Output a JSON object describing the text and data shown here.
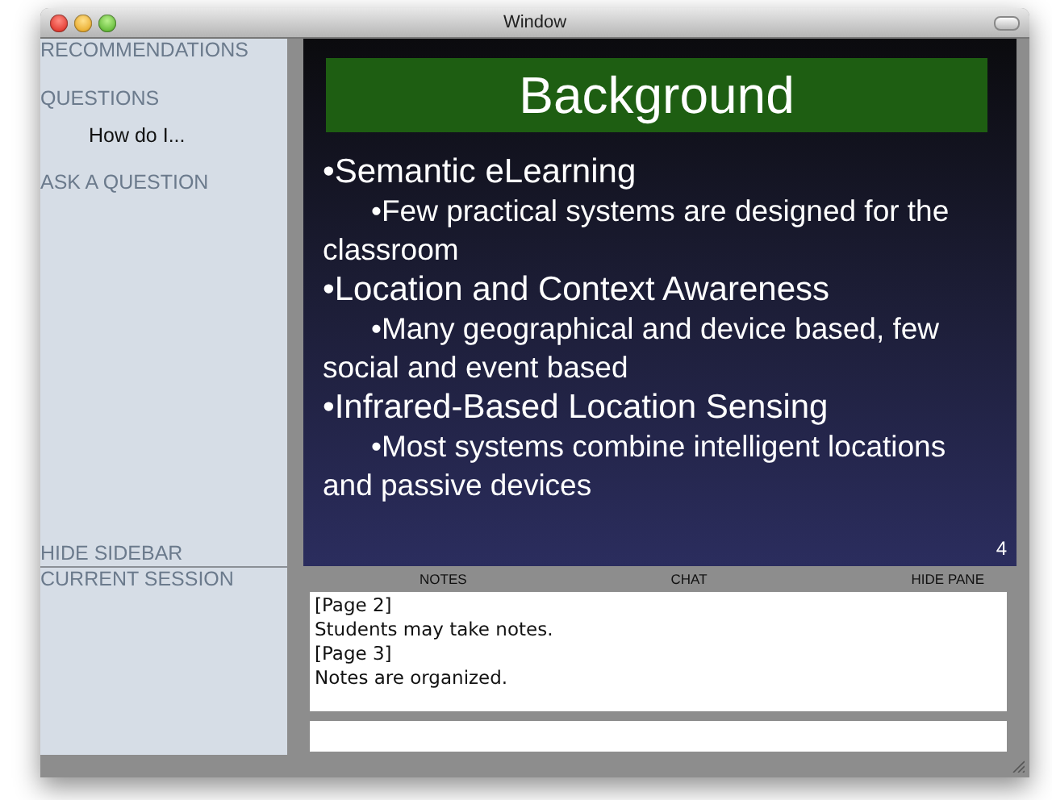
{
  "window": {
    "title": "Window"
  },
  "sidebar": {
    "items": [
      {
        "kind": "heading",
        "label": "RECOMMENDATIONS"
      },
      {
        "kind": "heading",
        "label": "QUESTIONS"
      },
      {
        "kind": "entry",
        "label": "How do I..."
      },
      {
        "kind": "heading",
        "label": "ASK A QUESTION"
      }
    ],
    "hide_label": "HIDE SIDEBAR",
    "session_label": "CURRENT SESSION"
  },
  "slide": {
    "title": "Background",
    "page_number": "4",
    "bullets": [
      {
        "text": "•Semantic eLearning",
        "children": [
          {
            "text": "•Few practical systems are designed for the classroom"
          }
        ]
      },
      {
        "text": "•Location and Context Awareness",
        "children": [
          {
            "text": "•Many geographical and device based, few social and event based"
          }
        ]
      },
      {
        "text": "•Infrared-Based Location Sensing",
        "children": [
          {
            "text": "•Most systems combine intelligent locations and passive devices"
          }
        ]
      }
    ]
  },
  "pane": {
    "tabs": [
      {
        "label": "NOTES"
      },
      {
        "label": "CHAT"
      },
      {
        "label": "HIDE PANE"
      }
    ],
    "notes": [
      "[Page 2]",
      "Students may take notes.",
      "[Page 3]",
      "Notes are organized."
    ]
  }
}
